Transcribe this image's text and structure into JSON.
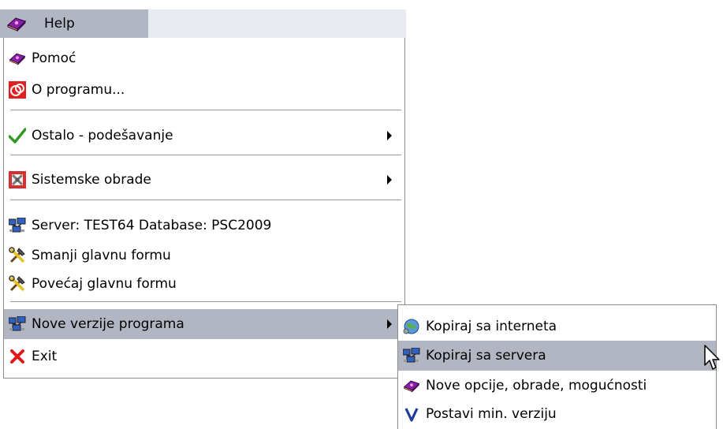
{
  "menubar": {
    "help_label": "Help"
  },
  "menu": {
    "items": [
      {
        "label": "Pomoć",
        "icon": "help-book-icon"
      },
      {
        "label": "O programu...",
        "icon": "about-icon"
      },
      {
        "label": "Ostalo - podešavanje",
        "icon": "checkmark-icon",
        "has_submenu": true
      },
      {
        "label": "Sistemske obrade",
        "icon": "system-tools-icon",
        "has_submenu": true
      },
      {
        "label": "Server: TEST64  Database: PSC2009",
        "icon": "network-computers-icon"
      },
      {
        "label": "Smanji glavnu formu",
        "icon": "hammer-wrench-icon"
      },
      {
        "label": "Povećaj glavnu formu",
        "icon": "hammer-wrench-icon"
      },
      {
        "label": "Nove verzije programa",
        "icon": "network-computers-icon",
        "has_submenu": true,
        "highlighted": true
      },
      {
        "label": "Exit",
        "icon": "red-x-icon"
      }
    ]
  },
  "submenu": {
    "items": [
      {
        "label": "Kopiraj sa interneta",
        "icon": "globe-icon"
      },
      {
        "label": "Kopiraj sa servera",
        "icon": "network-computers-icon",
        "highlighted": true
      },
      {
        "label": "Nove opcije, obrade, mogućnosti",
        "icon": "help-book-icon"
      },
      {
        "label": "Postavi min. verziju",
        "icon": "v-letter-icon"
      }
    ]
  },
  "colors": {
    "highlight": "#b2b6c2",
    "menubar": "#e8ebf0",
    "separator": "#9a9a9a"
  }
}
